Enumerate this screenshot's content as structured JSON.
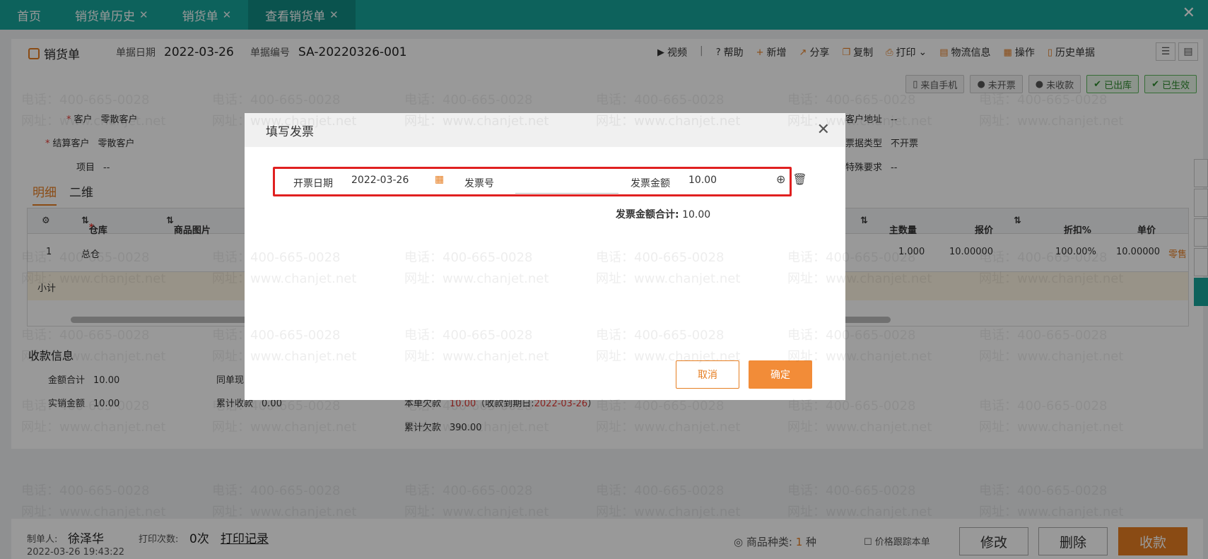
{
  "tabs": [
    {
      "label": "首页",
      "closable": false
    },
    {
      "label": "销货单历史",
      "closable": true
    },
    {
      "label": "销货单",
      "closable": true
    },
    {
      "label": "查看销货单",
      "closable": true,
      "active": true
    }
  ],
  "doc": {
    "title": "销货单",
    "date_label": "单据日期",
    "date_value": "2022-03-26",
    "number_label": "单据编号",
    "number_value": "SA-20220326-001"
  },
  "toolbar": {
    "video": "视频",
    "help": "帮助",
    "new": "新增",
    "share": "分享",
    "copy": "复制",
    "print": "打印",
    "logistics": "物流信息",
    "operate": "操作",
    "history": "历史单据"
  },
  "badges": {
    "mobile": "来自手机",
    "uninvoiced": "未开票",
    "unpaid": "未收款",
    "shipped": "已出库",
    "effective": "已生效"
  },
  "fields": {
    "customer_label": "客户",
    "customer_value": "零散客户",
    "settle_label": "结算客户",
    "settle_value": "零散客户",
    "project_label": "项目",
    "project_value": "--",
    "address_label": "客户地址",
    "address_value": "--",
    "bill_type_label": "票据类型",
    "bill_type_value": "不开票",
    "special_label": "特殊要求",
    "special_value": "--"
  },
  "subtabs": {
    "detail": "明细",
    "qr": "二维"
  },
  "grid": {
    "headers": {
      "warehouse": "仓库",
      "image": "商品图片",
      "main_qty": "主数量",
      "quote": "报价",
      "discount": "折扣%",
      "unit_price": "单价"
    },
    "row": {
      "no": "1",
      "warehouse": "总仓",
      "main_qty": "1.000",
      "quote": "10.00000",
      "discount": "100.00%",
      "unit_price": "10.00000",
      "extra": "零售"
    },
    "subtotal": "小计"
  },
  "payment": {
    "title": "收款信息",
    "total_label": "金额合计",
    "total_value": "10.00",
    "actual_label": "实销金额",
    "actual_value": "10.00",
    "same_label": "同单现",
    "accum_label": "累计收款",
    "accum_value": "0.00",
    "this_owe_label": "本单欠款",
    "this_owe_value": "10.00",
    "due_prefix": "（收款到期日:",
    "due_value": "2022-03-26",
    "due_suffix": "）",
    "total_owe_label": "累计欠款",
    "total_owe_value": "390.00"
  },
  "footer": {
    "maker_label": "制单人:",
    "maker_value": "徐泽华",
    "print_label": "打印次数:",
    "print_value": "0次",
    "print_record": "打印记录",
    "created_at": "2022-03-26 19:43:22",
    "kinds_label": "商品种类:",
    "kinds_value": "1",
    "kinds_unit": "种",
    "price_track": "价格跟踪本单",
    "edit": "修改",
    "delete": "删除",
    "collect": "收款"
  },
  "dialog": {
    "title": "填写发票",
    "invoice_date_label": "开票日期",
    "invoice_date_value": "2022-03-26",
    "invoice_no_label": "发票号",
    "invoice_no_value": "",
    "amount_label": "发票金额",
    "amount_value": "10.00",
    "total_label": "发票金额合计:",
    "total_value": "10.00",
    "cancel": "取消",
    "ok": "确定"
  },
  "watermark": {
    "phone": "电话：400-665-0028",
    "site": "网址：www.chanjet.net"
  }
}
